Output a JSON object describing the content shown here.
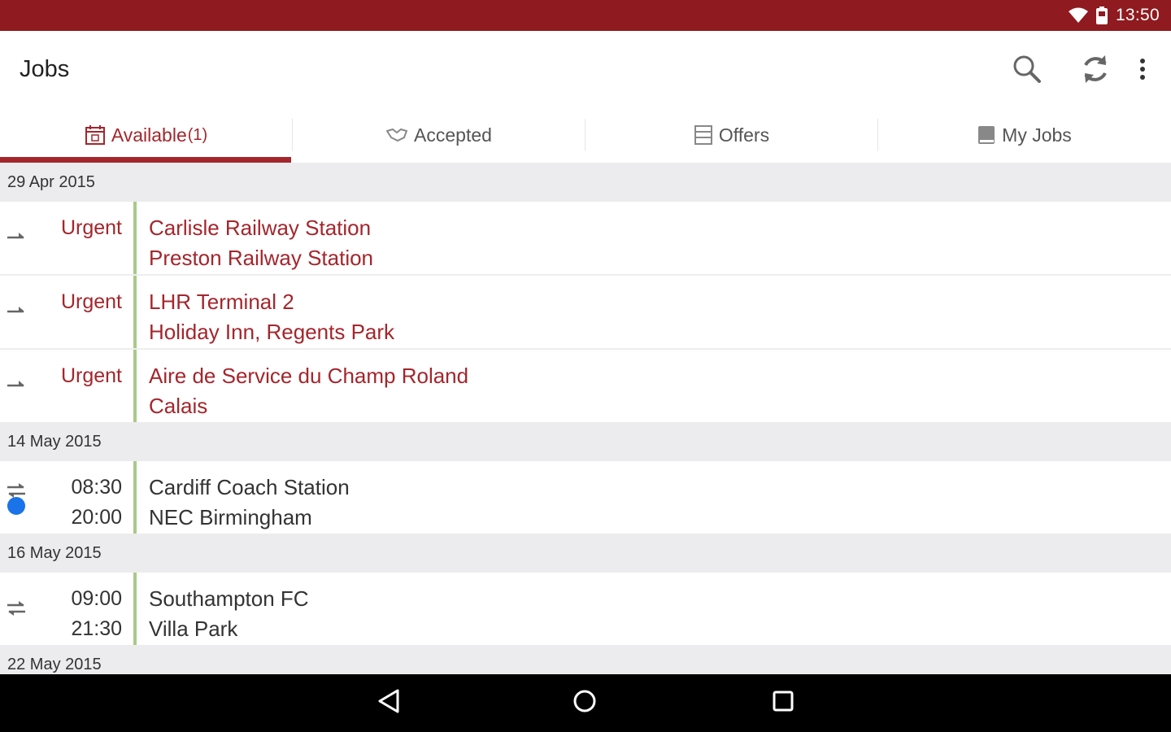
{
  "status_bar": {
    "time": "13:50",
    "icons": [
      "wifi-icon",
      "battery-icon"
    ]
  },
  "app_bar": {
    "title": "Jobs",
    "actions": [
      "search-icon",
      "sync-icon",
      "more-vert-icon"
    ]
  },
  "tabs": [
    {
      "label": "Available",
      "count": "(1)",
      "icon": "calendar-icon",
      "active": true
    },
    {
      "label": "Accepted",
      "icon": "handshake-icon",
      "active": false
    },
    {
      "label": "Offers",
      "icon": "list-icon",
      "active": false
    },
    {
      "label": "My Jobs",
      "icon": "book-icon",
      "active": false
    }
  ],
  "groups": [
    {
      "date": "29 Apr 2015",
      "jobs": [
        {
          "time_top": "Urgent",
          "time_bottom": "",
          "from": "Carlisle Railway Station",
          "to": "Preston Railway Station",
          "direction": "one-way",
          "urgent": true
        },
        {
          "time_top": "Urgent",
          "time_bottom": "",
          "from": "LHR Terminal 2",
          "to": "Holiday Inn, Regents Park",
          "direction": "one-way",
          "urgent": true
        },
        {
          "time_top": "Urgent",
          "time_bottom": "",
          "from": "Aire de Service du Champ Roland",
          "to": "Calais",
          "direction": "one-way",
          "urgent": true
        }
      ]
    },
    {
      "date": "14 May 2015",
      "jobs": [
        {
          "time_top": "08:30",
          "time_bottom": "20:00",
          "from": "Cardiff Coach Station",
          "to": "NEC Birmingham",
          "direction": "return",
          "urgent": false,
          "new_indicator": true
        }
      ]
    },
    {
      "date": "16 May 2015",
      "jobs": [
        {
          "time_top": "09:00",
          "time_bottom": "21:30",
          "from": "Southampton FC",
          "to": "Villa Park",
          "direction": "return",
          "urgent": false
        }
      ]
    },
    {
      "date": "22 May 2015",
      "jobs": []
    }
  ],
  "nav_bar": {
    "buttons": [
      "back-icon",
      "home-icon",
      "recents-icon"
    ]
  },
  "colors": {
    "primary": "#8f1a1f",
    "accent": "#a4262c",
    "divider": "#a9c98a",
    "indicator": "#1a73e8"
  }
}
